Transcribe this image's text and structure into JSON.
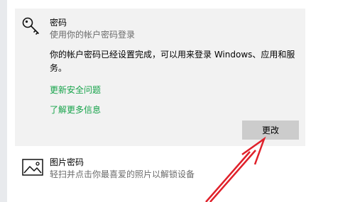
{
  "password_section": {
    "title": "密码",
    "subtitle": "使用你的帐户密码登录",
    "description": "你的帐户密码已经设置完成，可以用来登录 Windows、应用和服务。",
    "link_security_questions": "更新安全问题",
    "link_learn_more": "了解更多信息",
    "change_button": "更改",
    "icon": "key-icon"
  },
  "picture_password": {
    "title": "图片密码",
    "subtitle": "轻扫并点击你最喜爱的照片以解锁设备",
    "icon": "image-icon"
  },
  "colors": {
    "link": "#16a34a",
    "card_background": "#f2f2f2",
    "button_background": "#cccccc",
    "annotation_arrow": "#e0202a"
  }
}
